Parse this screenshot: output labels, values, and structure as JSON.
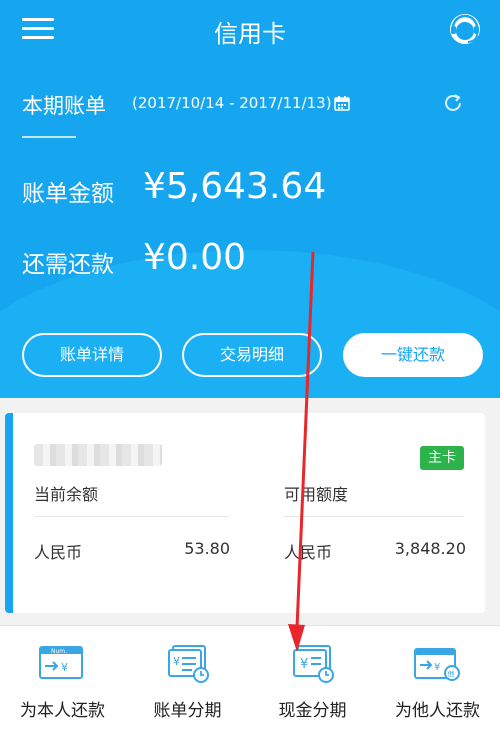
{
  "header": {
    "title": "信用卡",
    "menu_icon": "menu-icon",
    "service_icon": "customer-service-icon"
  },
  "bill": {
    "label": "本期账单",
    "range": "(2017/10/14 - 2017/11/13)",
    "amount_label": "账单金额",
    "amount": "¥5,643.64",
    "remaining_label": "还需还款",
    "remaining": "¥0.00"
  },
  "buttons": {
    "detail": "账单详情",
    "transactions": "交易明细",
    "repay": "一键还款"
  },
  "card": {
    "badge": "主卡",
    "balance_label": "当前余额",
    "credit_label": "可用额度",
    "currency_left": "人民币",
    "balance_value": "53.80",
    "currency_right": "人民币",
    "credit_value": "3,848.20"
  },
  "actions": [
    {
      "label": "为本人还款",
      "icon": "repay-self-icon"
    },
    {
      "label": "账单分期",
      "icon": "bill-installment-icon"
    },
    {
      "label": "现金分期",
      "icon": "cash-installment-icon"
    },
    {
      "label": "为他人还款",
      "icon": "repay-others-icon"
    }
  ],
  "colors": {
    "primary": "#16a6ef",
    "badge": "#2db34c",
    "annotation": "#e8262b"
  }
}
